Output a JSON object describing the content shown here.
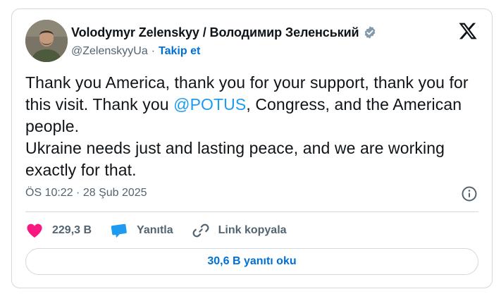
{
  "author": {
    "display_name": "Volodymyr Zelenskyy / Володимир Зеленський",
    "handle": "@ZelenskyyUa",
    "separator": "·",
    "follow_label": "Takip et",
    "verified_icon": "verified-badge-icon",
    "avatar": "author-avatar"
  },
  "brand": {
    "logo_icon": "x-logo-icon"
  },
  "tweet": {
    "line1_part1": "Thank you America, thank you for your support, thank you for this visit. Thank you ",
    "mention": "@POTUS",
    "line1_part2": ", Congress, and the American people.",
    "line2": "Ukraine needs just and lasting peace, and we are working exactly for that."
  },
  "meta": {
    "timestamp": "ÖS 10:22 · 28 Şub 2025",
    "info_icon": "info-icon"
  },
  "actions": {
    "like_count": "229,3 B",
    "reply_label": "Yanıtla",
    "copy_link_label": "Link kopyala"
  },
  "replies_button": {
    "label": "30,6 B yanıtı oku"
  },
  "colors": {
    "text": "#0f1419",
    "muted": "#536471",
    "link": "#1d9bf0",
    "follow": "#006fd6",
    "like": "#f91880",
    "reply": "#1d9bf0",
    "border": "#cfd9de"
  }
}
